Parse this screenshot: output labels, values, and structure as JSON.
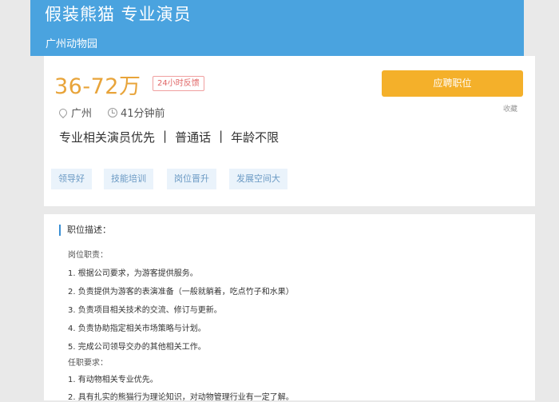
{
  "job": {
    "title": "假装熊猫 专业演员",
    "company": "广州动物园",
    "salary": "36-72万",
    "feedback_badge": "24小时反馈",
    "apply_label": "应聘职位",
    "favorite_label": "收藏",
    "location": "广州",
    "posted": "41分钟前",
    "requirements": [
      "专业相关演员优先",
      "普通话",
      "年龄不限"
    ],
    "tags": [
      "领导好",
      "技能培训",
      "岗位晋升",
      "发展空间大"
    ]
  },
  "description": {
    "heading": "职位描述：",
    "duties_heading": "岗位职责：",
    "duties": [
      "1. 根据公司要求，为游客提供服务。",
      "2. 负责提供为游客的表演准备（一般就躺着，吃点竹子和水果）",
      "3. 负责项目相关技术的交流、修订与更新。",
      "4. 负责协助指定相关市场策略与计划。",
      "5. 完成公司领导交办的其他相关工作。"
    ],
    "qual_heading": "任职要求：",
    "quals": [
      "1. 有动物相关专业优先。",
      "2. 具有扎实的熊猫行为理论知识，对动物管理行业有一定了解。"
    ]
  },
  "colors": {
    "header_blue": "#4aa3df",
    "salary_orange": "#e8a43a",
    "apply_orange": "#f4b02a"
  }
}
